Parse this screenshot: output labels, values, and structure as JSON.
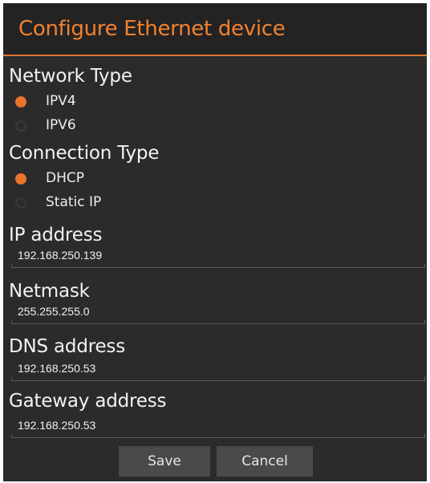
{
  "dialog": {
    "title": "Configure Ethernet device"
  },
  "network_type": {
    "label": "Network Type",
    "options": [
      {
        "label": "IPV4",
        "selected": true
      },
      {
        "label": "IPV6",
        "selected": false
      }
    ]
  },
  "connection_type": {
    "label": "Connection Type",
    "options": [
      {
        "label": "DHCP",
        "selected": true
      },
      {
        "label": "Static IP",
        "selected": false
      }
    ]
  },
  "fields": {
    "ip_address": {
      "label": "IP address",
      "value": "192.168.250.139"
    },
    "netmask": {
      "label": "Netmask",
      "value": "255.255.255.0"
    },
    "dns_address": {
      "label": "DNS address",
      "value": "192.168.250.53"
    },
    "gateway_address": {
      "label": "Gateway address",
      "value": "192.168.250.53"
    }
  },
  "buttons": {
    "save": "Save",
    "cancel": "Cancel"
  },
  "colors": {
    "accent": "#e8742e",
    "background": "#2b2b2b",
    "title_text": "#f0822f"
  }
}
